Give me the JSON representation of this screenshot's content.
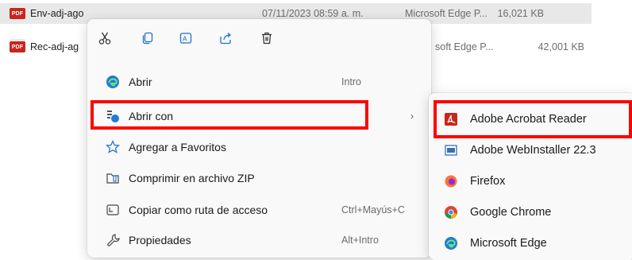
{
  "files": [
    {
      "name": "Env-adj-ago",
      "date": "07/11/2023 08:59 a. m.",
      "type": "Microsoft Edge P...",
      "size": "16,021 KB",
      "selected": true
    },
    {
      "name": "Rec-adj-ag",
      "date": "",
      "type": "soft Edge P...",
      "size": "42,001 KB",
      "selected": false
    }
  ],
  "pdf_badge": "PDF",
  "quick_actions": [
    {
      "name": "cut-icon"
    },
    {
      "name": "copy-icon"
    },
    {
      "name": "rename-icon"
    },
    {
      "name": "share-icon"
    },
    {
      "name": "delete-icon"
    }
  ],
  "menu": {
    "items": [
      {
        "label": "Abrir",
        "shortcut": "Intro",
        "icon": "edge-icon"
      },
      {
        "label": "Abrir con",
        "shortcut": "",
        "icon": "open-with-icon",
        "arrow": "›"
      },
      {
        "label": "Agregar a Favoritos",
        "shortcut": "",
        "icon": "star-icon"
      },
      {
        "label": "Comprimir en archivo ZIP",
        "shortcut": "",
        "icon": "zip-icon"
      },
      {
        "label": "Copiar como ruta de acceso",
        "shortcut": "Ctrl+Mayús+C",
        "icon": "path-icon"
      },
      {
        "label": "Propiedades",
        "shortcut": "Alt+Intro",
        "icon": "wrench-icon"
      }
    ]
  },
  "submenu": {
    "items": [
      {
        "label": "Adobe Acrobat Reader",
        "icon": "acrobat-icon"
      },
      {
        "label": "Adobe WebInstaller 22.3",
        "icon": "installer-icon"
      },
      {
        "label": "Firefox",
        "icon": "firefox-icon"
      },
      {
        "label": "Google Chrome",
        "icon": "chrome-icon"
      },
      {
        "label": "Microsoft Edge",
        "icon": "edge-icon"
      }
    ]
  },
  "colors": {
    "highlight": "#ff0000",
    "acrobat": "#c8261c",
    "edge_blue": "#1f7bd6"
  }
}
